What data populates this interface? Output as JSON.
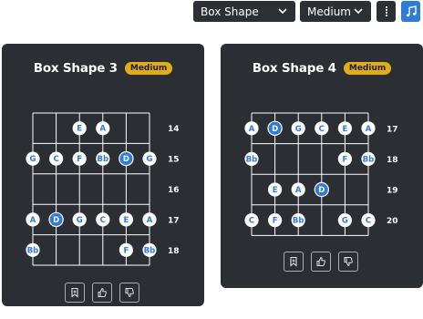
{
  "toolbar": {
    "shape_select": "Box Shape",
    "difficulty_select": "Medium",
    "dots_icon": "vertical-dots-icon",
    "note_icon": "music-note-icon",
    "accent_color": "#2e7bd8"
  },
  "cards": [
    {
      "title": "Box Shape 3",
      "badge": "Medium",
      "frets": [
        "14",
        "15",
        "16",
        "17",
        "18"
      ],
      "notes": [
        {
          "string": 3,
          "fret": 0,
          "label": "E",
          "root": false
        },
        {
          "string": 4,
          "fret": 0,
          "label": "A",
          "root": false
        },
        {
          "string": 1,
          "fret": 1,
          "label": "G",
          "root": false
        },
        {
          "string": 2,
          "fret": 1,
          "label": "C",
          "root": false
        },
        {
          "string": 3,
          "fret": 1,
          "label": "F",
          "root": false
        },
        {
          "string": 4,
          "fret": 1,
          "label": "Bb",
          "root": false
        },
        {
          "string": 5,
          "fret": 1,
          "label": "D",
          "root": true
        },
        {
          "string": 6,
          "fret": 1,
          "label": "G",
          "root": false
        },
        {
          "string": 1,
          "fret": 3,
          "label": "A",
          "root": false
        },
        {
          "string": 2,
          "fret": 3,
          "label": "D",
          "root": true
        },
        {
          "string": 3,
          "fret": 3,
          "label": "G",
          "root": false
        },
        {
          "string": 4,
          "fret": 3,
          "label": "C",
          "root": false
        },
        {
          "string": 5,
          "fret": 3,
          "label": "E",
          "root": false
        },
        {
          "string": 6,
          "fret": 3,
          "label": "A",
          "root": false
        },
        {
          "string": 1,
          "fret": 4,
          "label": "Bb",
          "root": false
        },
        {
          "string": 5,
          "fret": 4,
          "label": "F",
          "root": false
        },
        {
          "string": 6,
          "fret": 4,
          "label": "Bb",
          "root": false
        }
      ]
    },
    {
      "title": "Box Shape 4",
      "badge": "Medium",
      "frets": [
        "17",
        "18",
        "19",
        "20"
      ],
      "notes": [
        {
          "string": 1,
          "fret": 0,
          "label": "A",
          "root": false
        },
        {
          "string": 2,
          "fret": 0,
          "label": "D",
          "root": true
        },
        {
          "string": 3,
          "fret": 0,
          "label": "G",
          "root": false
        },
        {
          "string": 4,
          "fret": 0,
          "label": "C",
          "root": false
        },
        {
          "string": 5,
          "fret": 0,
          "label": "E",
          "root": false
        },
        {
          "string": 6,
          "fret": 0,
          "label": "A",
          "root": false
        },
        {
          "string": 1,
          "fret": 1,
          "label": "Bb",
          "root": false
        },
        {
          "string": 5,
          "fret": 1,
          "label": "F",
          "root": false
        },
        {
          "string": 6,
          "fret": 1,
          "label": "Bb",
          "root": false
        },
        {
          "string": 2,
          "fret": 2,
          "label": "E",
          "root": false
        },
        {
          "string": 3,
          "fret": 2,
          "label": "A",
          "root": false
        },
        {
          "string": 4,
          "fret": 2,
          "label": "D",
          "root": true
        },
        {
          "string": 1,
          "fret": 3,
          "label": "C",
          "root": false
        },
        {
          "string": 2,
          "fret": 3,
          "label": "F",
          "root": false
        },
        {
          "string": 3,
          "fret": 3,
          "label": "Bb",
          "root": false
        },
        {
          "string": 5,
          "fret": 3,
          "label": "G",
          "root": false
        },
        {
          "string": 6,
          "fret": 3,
          "label": "C",
          "root": false
        }
      ]
    }
  ],
  "actions": {
    "bookmark_icon": "bookmark-icon",
    "like_icon": "thumbs-up-icon",
    "dislike_icon": "thumbs-down-icon"
  },
  "colors": {
    "card_bg": "#2b2e33",
    "badge": "#e2ad17",
    "root_note": "#2e7bd8",
    "note_text": "#2e7bd8"
  }
}
